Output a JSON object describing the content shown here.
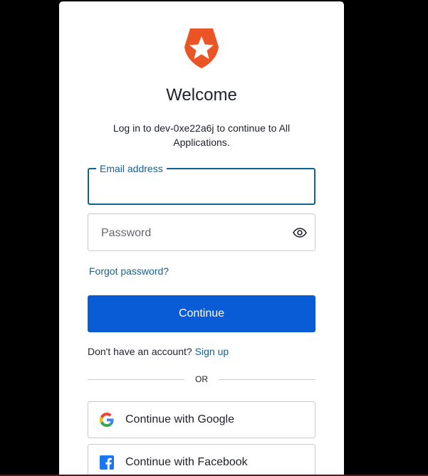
{
  "colors": {
    "accent": "#0a5bd6",
    "link": "#0e6394",
    "brand_logo": "#eb5424"
  },
  "header": {
    "logo_icon": "auth0-shield-star-icon",
    "title": "Welcome",
    "subtitle": "Log in to dev-0xe22a6j to continue to All Applications."
  },
  "form": {
    "email": {
      "label": "Email address",
      "value": "",
      "state": "focused"
    },
    "password": {
      "placeholder": "Password",
      "value": "",
      "toggle_icon": "eye-icon"
    },
    "forgot_password_label": "Forgot password?",
    "continue_label": "Continue"
  },
  "signup": {
    "prompt": "Don't have an account?",
    "link_label": "Sign up"
  },
  "divider_label": "OR",
  "social": [
    {
      "label": "Continue with Google",
      "icon": "google-icon"
    },
    {
      "label": "Continue with Facebook",
      "icon": "facebook-icon"
    }
  ]
}
